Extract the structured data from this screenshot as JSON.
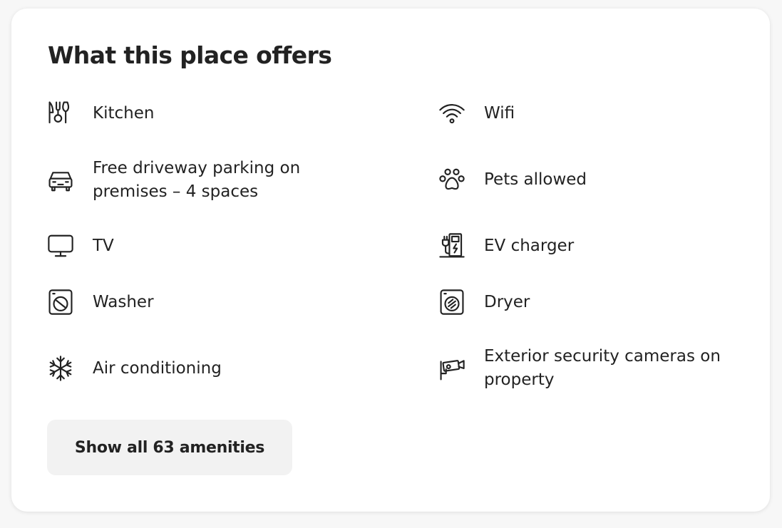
{
  "section": {
    "title": "What this place offers"
  },
  "amenities": [
    {
      "label": "Kitchen",
      "icon": "kitchen-icon"
    },
    {
      "label": "Wifi",
      "icon": "wifi-icon"
    },
    {
      "label": "Free driveway parking on premises – 4 spaces",
      "icon": "car-icon"
    },
    {
      "label": "Pets allowed",
      "icon": "paw-icon"
    },
    {
      "label": "TV",
      "icon": "tv-icon"
    },
    {
      "label": "EV charger",
      "icon": "ev-charger-icon"
    },
    {
      "label": "Washer",
      "icon": "washer-icon"
    },
    {
      "label": "Dryer",
      "icon": "dryer-icon"
    },
    {
      "label": "Air conditioning",
      "icon": "snowflake-icon"
    },
    {
      "label": "Exterior security cameras on property",
      "icon": "security-camera-icon"
    }
  ],
  "button": {
    "label": "Show all 63 amenities"
  }
}
